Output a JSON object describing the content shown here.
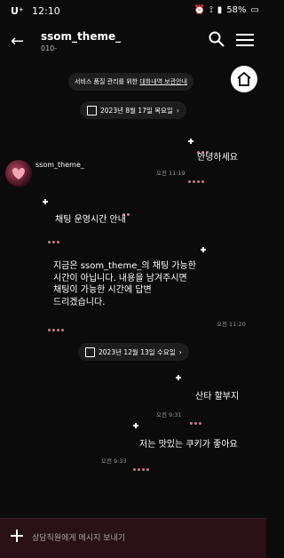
{
  "status_bar": {
    "carrier": "U⁺",
    "time": "12:10",
    "battery": "58%"
  },
  "header": {
    "title": "ssom_theme_",
    "subtitle": "010-",
    "back_icon": "arrow-left-icon",
    "search_icon": "search-icon",
    "menu_icon": "hamburger-menu-icon"
  },
  "notice": {
    "text": "서비스 품질 관리를 위한",
    "link": "대화내역 보관안내"
  },
  "dates": [
    "2023년 8월 17일 목요일",
    "2023년 12월 13일 수요일"
  ],
  "messages": [
    {
      "from": "me",
      "text": "안녕하세요",
      "meta": "오전 11:19"
    },
    {
      "from": "ssom_theme_",
      "text": "채팅 운영시간 안내"
    },
    {
      "from": "ssom_theme_",
      "text": "지금은 ssom_theme_의 채팅 가능한\n시간이 아닙니다. 내용을 남겨주시면\n채팅이 가능한 시간에 답변\n드리겠습니다.",
      "meta": "오전 11:20"
    },
    {
      "from": "me",
      "text": "산타 할부지",
      "meta": "오전 9:31"
    },
    {
      "from": "me",
      "text": "저는 맛있는 쿠키가 좋아요",
      "meta": "오전 9:33"
    }
  ],
  "input": {
    "placeholder": "상담직원에게 메시지 보내기"
  }
}
